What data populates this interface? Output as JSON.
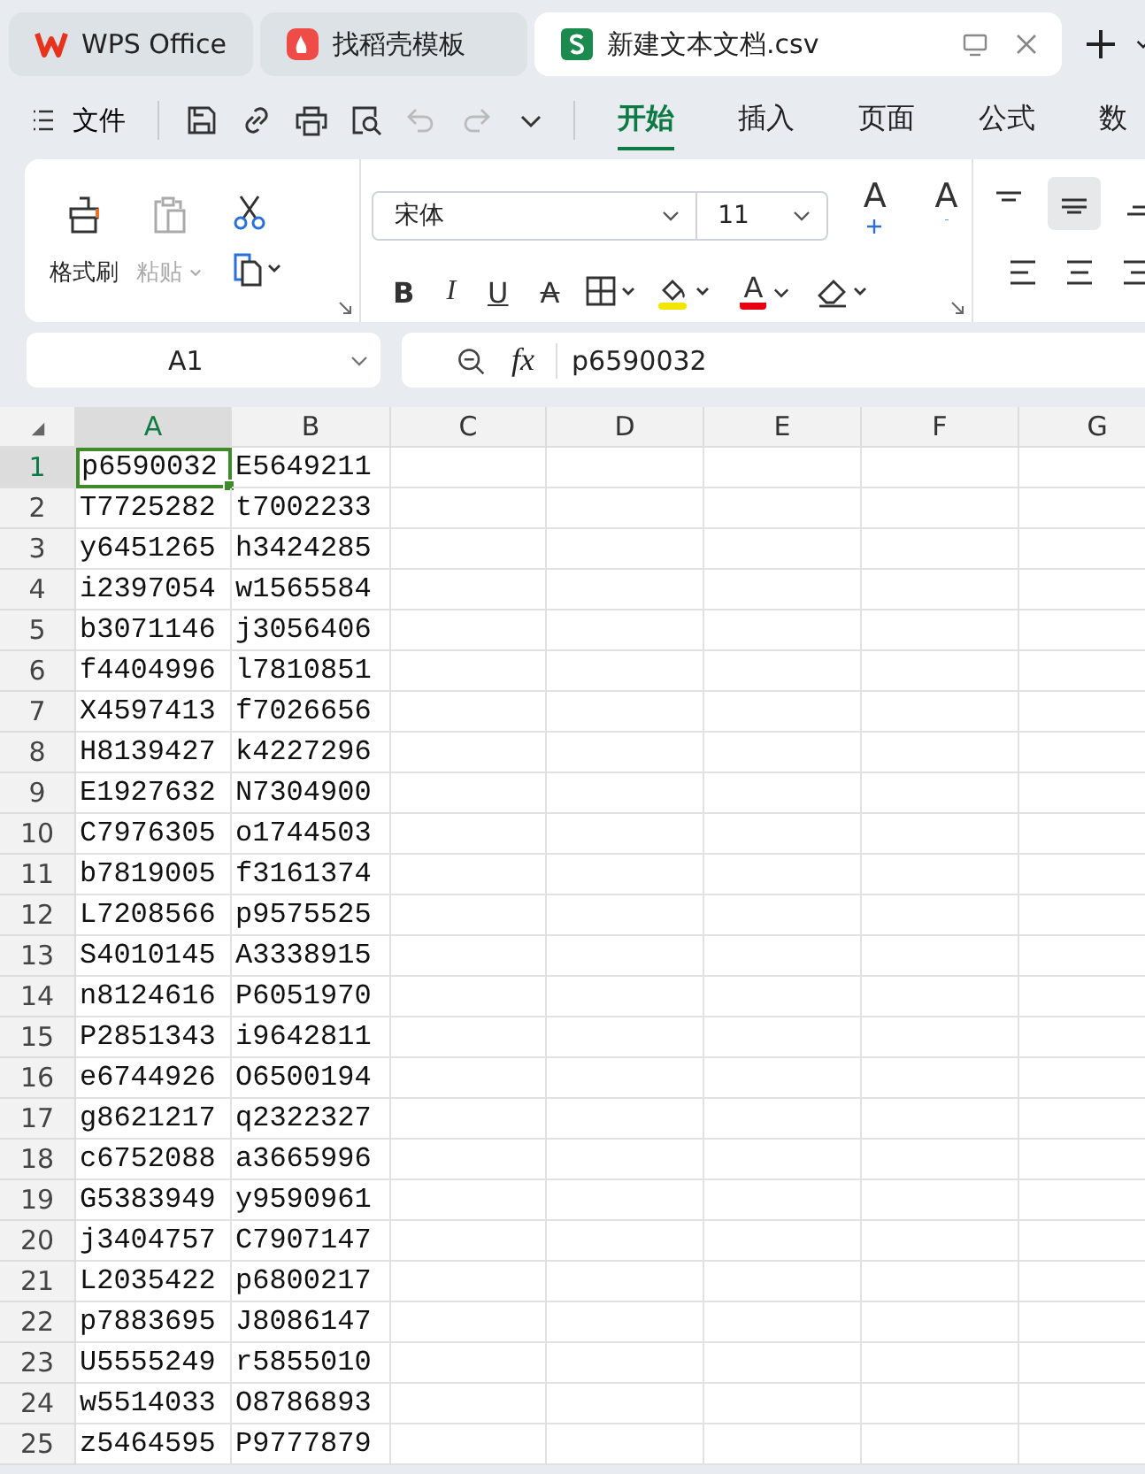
{
  "browser_tabs": [
    {
      "label": "WPS Office",
      "kind": "wps",
      "selected": false
    },
    {
      "label": "找稻壳模板",
      "kind": "docer",
      "selected": false
    },
    {
      "label": "新建文本文档.csv",
      "kind": "sheet",
      "selected": true
    }
  ],
  "toolbar": {
    "file_menu": "文件",
    "undo_disabled": true,
    "redo_disabled": true
  },
  "ribbon_tabs": [
    {
      "label": "开始",
      "selected": true
    },
    {
      "label": "插入",
      "selected": false
    },
    {
      "label": "页面",
      "selected": false
    },
    {
      "label": "公式",
      "selected": false
    },
    {
      "label": "数",
      "selected": false
    }
  ],
  "ribbon": {
    "format_painter": "格式刷",
    "paste": {
      "label": "粘贴",
      "disabled": true
    },
    "font_name": "宋体",
    "font_size": "11",
    "grow_font": "A",
    "shrink_font": "A",
    "bold": "B",
    "italic": "I",
    "underline": "U",
    "strikethrough": "A",
    "font_color": "A"
  },
  "name_box": "A1",
  "formula_label": "fx",
  "formula": "p6590032",
  "sheet": {
    "columns": [
      {
        "label": "A",
        "selected": true
      },
      {
        "label": "B",
        "selected": false
      },
      {
        "label": "C",
        "selected": false
      },
      {
        "label": "D",
        "selected": false
      },
      {
        "label": "E",
        "selected": false
      },
      {
        "label": "F",
        "selected": false
      },
      {
        "label": "G",
        "selected": false
      }
    ],
    "rows": [
      {
        "number": "1",
        "selected": true,
        "cells": [
          "p6590032",
          "E5649211"
        ]
      },
      {
        "number": "2",
        "selected": false,
        "cells": [
          "T7725282",
          "t7002233"
        ]
      },
      {
        "number": "3",
        "selected": false,
        "cells": [
          "y6451265",
          "h3424285"
        ]
      },
      {
        "number": "4",
        "selected": false,
        "cells": [
          "i2397054",
          "w1565584"
        ]
      },
      {
        "number": "5",
        "selected": false,
        "cells": [
          "b3071146",
          "j3056406"
        ]
      },
      {
        "number": "6",
        "selected": false,
        "cells": [
          "f4404996",
          "l7810851"
        ]
      },
      {
        "number": "7",
        "selected": false,
        "cells": [
          "X4597413",
          "f7026656"
        ]
      },
      {
        "number": "8",
        "selected": false,
        "cells": [
          "H8139427",
          "k4227296"
        ]
      },
      {
        "number": "9",
        "selected": false,
        "cells": [
          "E1927632",
          "N7304900"
        ]
      },
      {
        "number": "10",
        "selected": false,
        "cells": [
          "C7976305",
          "o1744503"
        ]
      },
      {
        "number": "11",
        "selected": false,
        "cells": [
          "b7819005",
          "f3161374"
        ]
      },
      {
        "number": "12",
        "selected": false,
        "cells": [
          "L7208566",
          "p9575525"
        ]
      },
      {
        "number": "13",
        "selected": false,
        "cells": [
          "S4010145",
          "A3338915"
        ]
      },
      {
        "number": "14",
        "selected": false,
        "cells": [
          "n8124616",
          "P6051970"
        ]
      },
      {
        "number": "15",
        "selected": false,
        "cells": [
          "P2851343",
          "i9642811"
        ]
      },
      {
        "number": "16",
        "selected": false,
        "cells": [
          "e6744926",
          "O6500194"
        ]
      },
      {
        "number": "17",
        "selected": false,
        "cells": [
          "g8621217",
          "q2322327"
        ]
      },
      {
        "number": "18",
        "selected": false,
        "cells": [
          "c6752088",
          "a3665996"
        ]
      },
      {
        "number": "19",
        "selected": false,
        "cells": [
          "G5383949",
          "y9590961"
        ]
      },
      {
        "number": "20",
        "selected": false,
        "cells": [
          "j3404757",
          "C7907147"
        ]
      },
      {
        "number": "21",
        "selected": false,
        "cells": [
          "L2035422",
          "p6800217"
        ]
      },
      {
        "number": "22",
        "selected": false,
        "cells": [
          "p7883695",
          "J8086147"
        ]
      },
      {
        "number": "23",
        "selected": false,
        "cells": [
          "U5555249",
          "r5855010"
        ]
      },
      {
        "number": "24",
        "selected": false,
        "cells": [
          "w5514033",
          "O8786893"
        ]
      },
      {
        "number": "25",
        "selected": false,
        "cells": [
          "z5464595",
          "P9777879"
        ]
      }
    ]
  }
}
